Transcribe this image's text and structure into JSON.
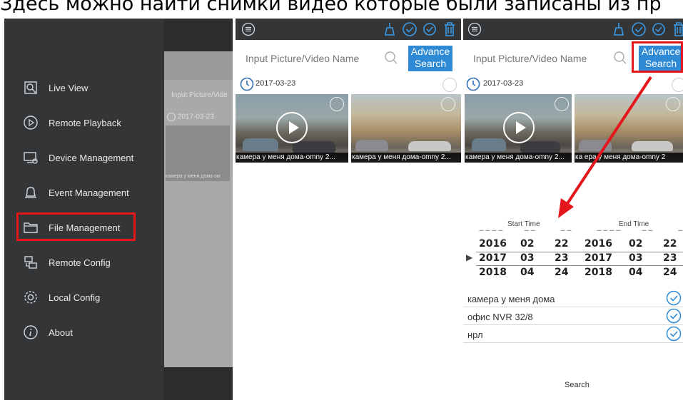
{
  "caption": "Здесь можно найти снимки видео которые были записаны из пр",
  "drawer": {
    "items": [
      {
        "label": "Live View",
        "icon": "live-view-icon"
      },
      {
        "label": "Remote Playback",
        "icon": "remote-playback-icon"
      },
      {
        "label": "Device Management",
        "icon": "device-management-icon"
      },
      {
        "label": "Event Management",
        "icon": "bell-icon"
      },
      {
        "label": "File Management",
        "icon": "folder-icon"
      },
      {
        "label": "Remote Config",
        "icon": "remote-config-icon"
      },
      {
        "label": "Local Config",
        "icon": "gear-icon"
      },
      {
        "label": "About",
        "icon": "info-icon"
      }
    ],
    "ghost_search": "Input Picture/Vide",
    "ghost_date": "2017-03-23",
    "ghost_caption": "камера у меня дома ом"
  },
  "files": {
    "search_placeholder": "Input Picture/Video Name",
    "advance_line1": "Advance",
    "advance_line2": "Search",
    "date": "2017-03-23",
    "thumbs": [
      {
        "caption": "камера у меня дома-omny 2..."
      },
      {
        "caption": "камера у меня дома-omny 2..."
      }
    ]
  },
  "advanced": {
    "search_placeholder": "Input Picture/Video Name",
    "advance_line1": "Advance",
    "advance_line2": "Search",
    "date": "2017-03-23",
    "thumbs": [
      {
        "caption": "камера у меня дома-omny 2..."
      },
      {
        "caption": "ка  ера у меня дома-omny 2"
      }
    ],
    "start_label": "Start Time",
    "end_label": "End Time",
    "rows": [
      [
        "2016",
        "02",
        "22",
        "2016",
        "02",
        "22"
      ],
      [
        "2017",
        "03",
        "23",
        "2017",
        "03",
        "23"
      ],
      [
        "2018",
        "04",
        "24",
        "2018",
        "04",
        "24"
      ]
    ],
    "channels": [
      "камера у меня дома",
      "офис NVR 32/8",
      "нрл"
    ],
    "search_label": "Search"
  },
  "colors": {
    "accent": "#2f8ad6",
    "highlight": "#e3161b",
    "bar": "#333537"
  }
}
